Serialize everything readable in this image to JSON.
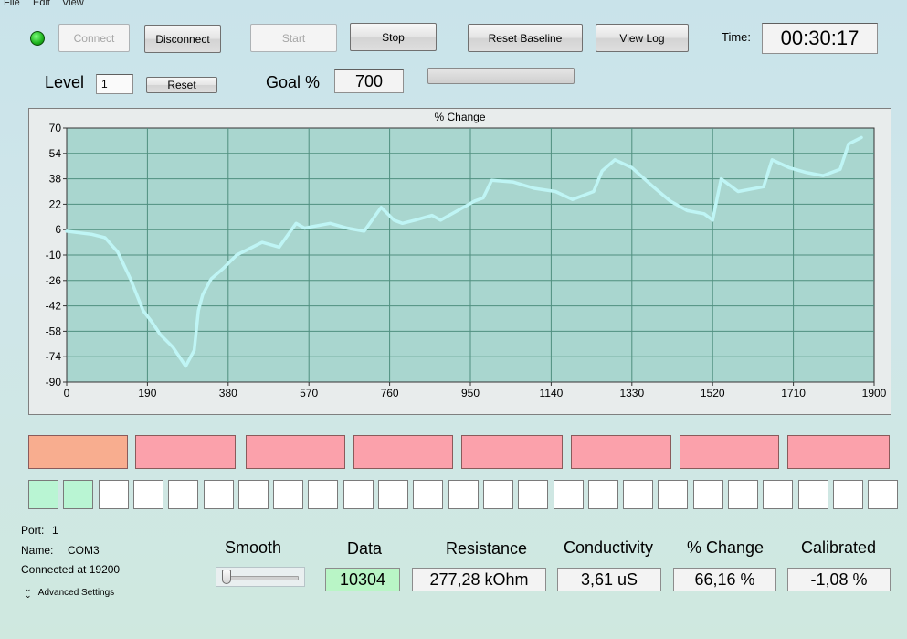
{
  "menu": [
    "File",
    "Edit",
    "View"
  ],
  "toolbar": {
    "connect": "Connect",
    "disconnect": "Disconnect",
    "start": "Start",
    "stop": "Stop",
    "reset_baseline": "Reset Baseline",
    "view_log": "View Log",
    "time_label": "Time:",
    "time_value": "00:30:17"
  },
  "level": {
    "label": "Level",
    "value": "1",
    "reset": "Reset"
  },
  "goal": {
    "label": "Goal %",
    "value": "700"
  },
  "colors": {
    "led": "#22c022",
    "plot_bg": "#a9d6cf",
    "line": "#bff5f5",
    "grid": "#4f8f7f"
  },
  "chart_data": {
    "type": "line",
    "title": "% Change",
    "xlim": [
      0,
      1900
    ],
    "ylim": [
      -90,
      70
    ],
    "xticks": [
      "0",
      "190",
      "380",
      "570",
      "760",
      "950",
      "1140",
      "1330",
      "1520",
      "1710",
      "1900"
    ],
    "yticks": [
      "70",
      "54",
      "38",
      "22",
      "6",
      "-10",
      "-26",
      "-42",
      "-58",
      "-74",
      "-90"
    ],
    "grid": true,
    "series": [
      {
        "x": [
          0,
          30,
          60,
          90,
          120,
          150,
          180,
          200,
          220,
          250,
          280,
          300,
          310,
          320,
          340,
          370,
          400,
          430,
          460,
          500,
          540,
          560,
          580,
          620,
          660,
          700,
          740,
          770,
          790,
          820,
          860,
          880,
          920,
          960,
          980,
          1000,
          1050,
          1100,
          1150,
          1190,
          1220,
          1240,
          1260,
          1290,
          1330,
          1380,
          1420,
          1460,
          1500,
          1520,
          1540,
          1580,
          1640,
          1660,
          1700,
          1740,
          1780,
          1820,
          1840,
          1870
        ],
        "y": [
          5,
          4,
          3,
          1,
          -8,
          -25,
          -45,
          -52,
          -60,
          -68,
          -80,
          -70,
          -45,
          -35,
          -25,
          -18,
          -10,
          -6,
          -2,
          -5,
          10,
          7,
          8,
          10,
          7,
          5,
          20,
          12,
          10,
          12,
          15,
          12,
          18,
          24,
          26,
          37,
          36,
          32,
          30,
          25,
          28,
          30,
          43,
          50,
          45,
          33,
          24,
          18,
          16,
          12,
          38,
          30,
          33,
          50,
          45,
          42,
          40,
          44,
          60,
          64
        ]
      }
    ]
  },
  "status_boxes": [
    {
      "color": "#f8ad8f"
    },
    {
      "color": "#fba1ab"
    },
    {
      "color": "#fba1ab"
    },
    {
      "color": "#fba1ab"
    },
    {
      "color": "#fba1ab"
    },
    {
      "color": "#fba1ab"
    },
    {
      "color": "#fba1ab"
    },
    {
      "color": "#fba1ab"
    }
  ],
  "progress_cells": {
    "filled": 2,
    "total": 25,
    "fill_color": "#b9f5d3"
  },
  "connection": {
    "port_label": "Port:",
    "port_value": "1",
    "name_label": "Name:",
    "name_value": "COM3",
    "status": "Connected at 19200",
    "advanced": "Advanced Settings"
  },
  "stats": {
    "smooth": "Smooth",
    "data_label": "Data",
    "data_value": "10304",
    "resistance_label": "Resistance",
    "resistance_value": "277,28 kOhm",
    "conductivity_label": "Conductivity",
    "conductivity_value": "3,61 uS",
    "change_label": "% Change",
    "change_value": "66,16 %",
    "calibrated_label": "Calibrated",
    "calibrated_value": "-1,08 %"
  }
}
